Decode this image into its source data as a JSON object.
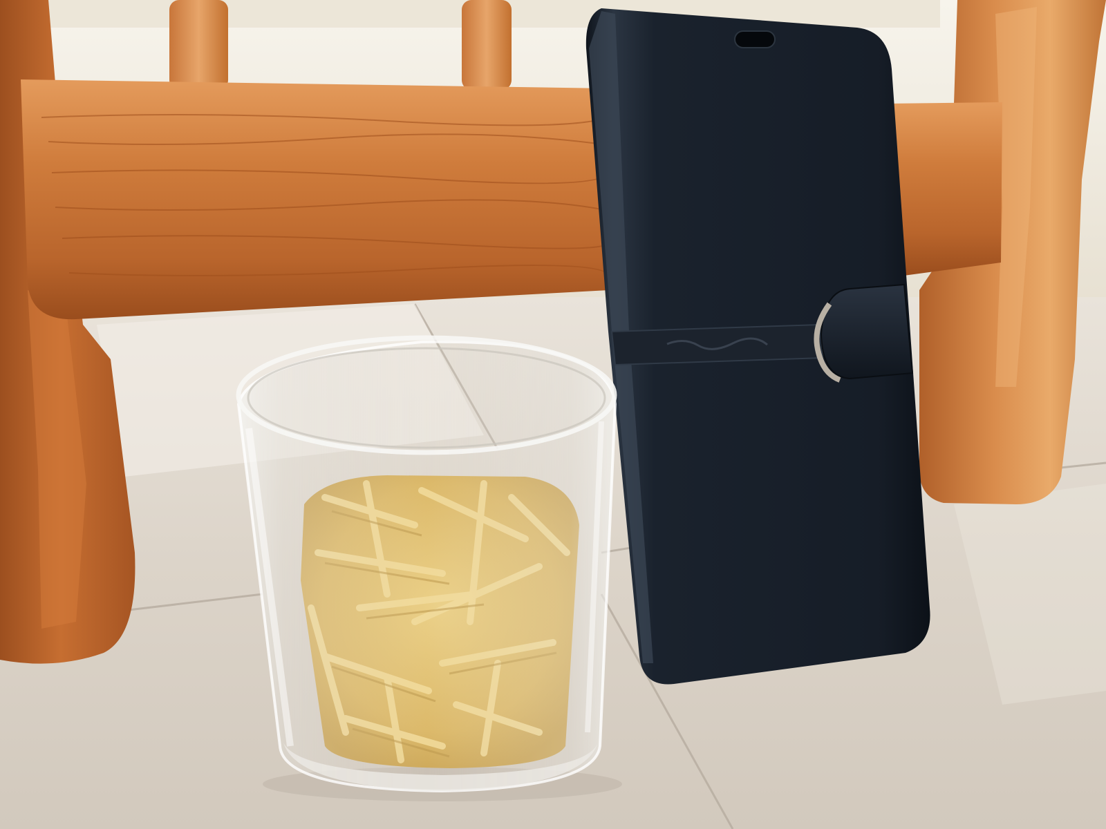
{
  "scene": {
    "description_free": true,
    "case_brand_text": "",
    "colors": {
      "wall_cream": "#f1ece0",
      "wood_light": "#d9884a",
      "wood_dark": "#a8521f",
      "tile_light": "#e2dbd1",
      "tile_grout": "#b9b0a6",
      "case_black": "#141b24",
      "pasta_yellow": "#e3c06a",
      "glass_edge": "#f3f3f1"
    }
  }
}
